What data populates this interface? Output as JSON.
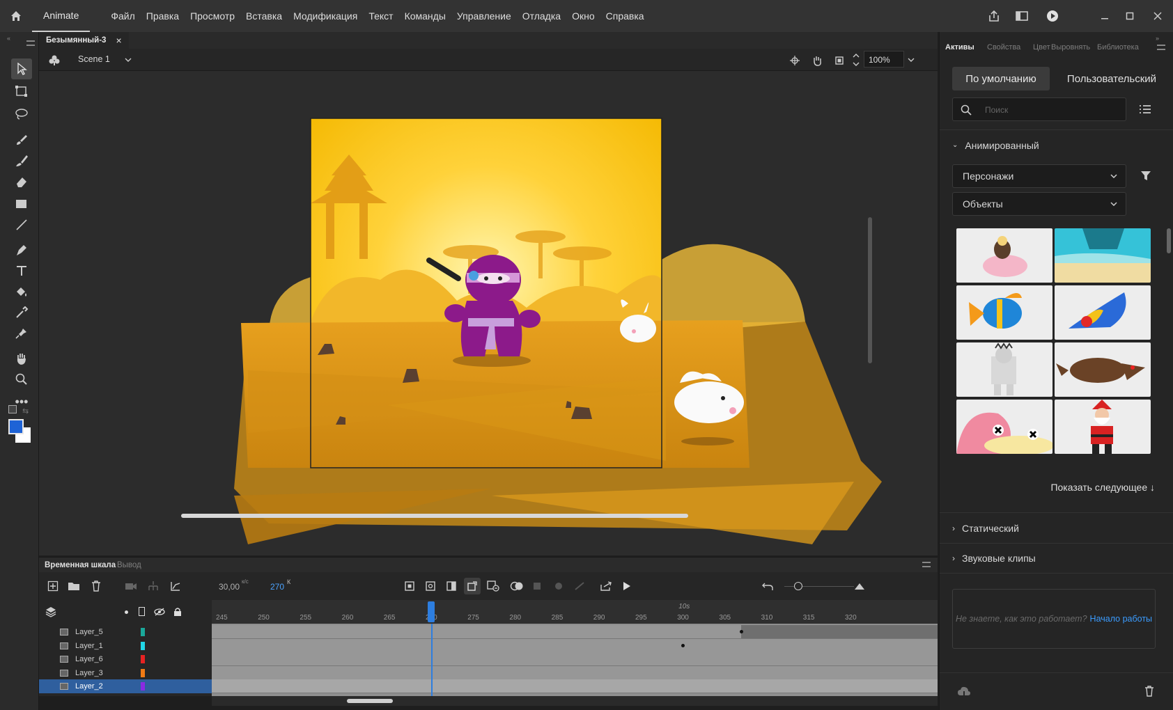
{
  "app": {
    "brand": "Animate",
    "home_icon": "home-icon"
  },
  "menu": [
    "Файл",
    "Правка",
    "Просмотр",
    "Вставка",
    "Модификация",
    "Текст",
    "Команды",
    "Управление",
    "Отладка",
    "Окно",
    "Справка"
  ],
  "document": {
    "tab_title": "Безымянный-3",
    "close_glyph": "×",
    "scene": "Scene 1",
    "zoom": "100%"
  },
  "timeline": {
    "tabs": [
      "Временная шкала",
      "Вывод"
    ],
    "fps_value": "30,00",
    "fps_unit": "к/с",
    "frame_value": "270",
    "frame_unit": "К",
    "time_marker": "10s",
    "current_frame": 270,
    "ruler_start": 245,
    "ruler_end": 320,
    "ruler_ticks": [
      "245",
      "250",
      "255",
      "260",
      "265",
      "270",
      "275",
      "280",
      "285",
      "290",
      "295",
      "300",
      "305",
      "310",
      "315",
      "320"
    ],
    "layers": [
      {
        "name": "Layer_5",
        "color": "#1aa89a",
        "selected": false
      },
      {
        "name": "Layer_1",
        "color": "#21d6e6",
        "selected": false
      },
      {
        "name": "Layer_6",
        "color": "#e62222",
        "selected": false
      },
      {
        "name": "Layer_3",
        "color": "#f07a14",
        "selected": false
      },
      {
        "name": "Layer_2",
        "color": "#8a2be2",
        "selected": true
      }
    ]
  },
  "panel": {
    "tabs": [
      "Активы",
      "Свойства",
      "Цвет",
      "Выровнять",
      "Библиотека"
    ],
    "toggle": [
      "По умолчанию",
      "Пользовательский"
    ],
    "search_placeholder": "Поиск",
    "section_animated": "Анимированный",
    "dropdown_characters": "Персонажи",
    "dropdown_objects": "Объекты",
    "show_next": "Показать следующее ↓",
    "section_static": "Статический",
    "section_sound": "Звуковые клипы",
    "help_text": "Не знаете, как это работает?",
    "help_link": "Начало работы"
  },
  "colors": {
    "accent": "#2d8ceb",
    "stroke": "#1a73e8",
    "fill_swatch": "#1e63d6"
  }
}
